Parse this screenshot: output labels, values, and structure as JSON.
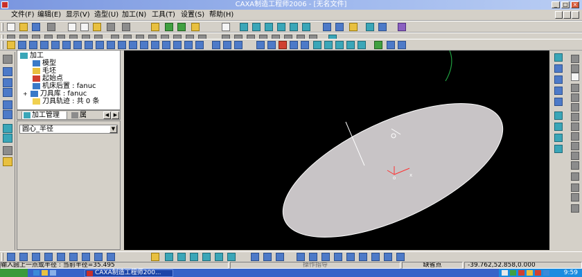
{
  "window": {
    "title": "CAXA制造工程师2006 - [无名文件]"
  },
  "menu": {
    "items": [
      "文件(F)",
      "编辑(E)",
      "显示(V)",
      "造型(U)",
      "加工(N)",
      "工具(T)",
      "设置(S)",
      "帮助(H)"
    ]
  },
  "tree": {
    "root": "加工",
    "items": [
      "模型",
      "毛坯",
      "起始点",
      "机床后置 : fanuc",
      "刀具库 : fanuc",
      "刀具轨迹 : 共 0 条"
    ]
  },
  "tabs": {
    "active": "加工管理",
    "other": "属"
  },
  "combo": {
    "value": "圆心_半径"
  },
  "canvas": {
    "axis_label_x": "x",
    "axis_label_origin": "o",
    "colors": {
      "background": "#000000",
      "ellipse": "#c8c4c6",
      "curve": "#20a040",
      "axis_x": "#ff3030"
    }
  },
  "status": {
    "prompt": "输入圆上一点或半径 : 当前半径=35.495",
    "middle": "操作指导",
    "mode": "缺省点",
    "coords": "-39.762,52.858,0.000"
  },
  "taskbar": {
    "task_label": "CAXA制造工程师200...",
    "clock": "9:59"
  }
}
